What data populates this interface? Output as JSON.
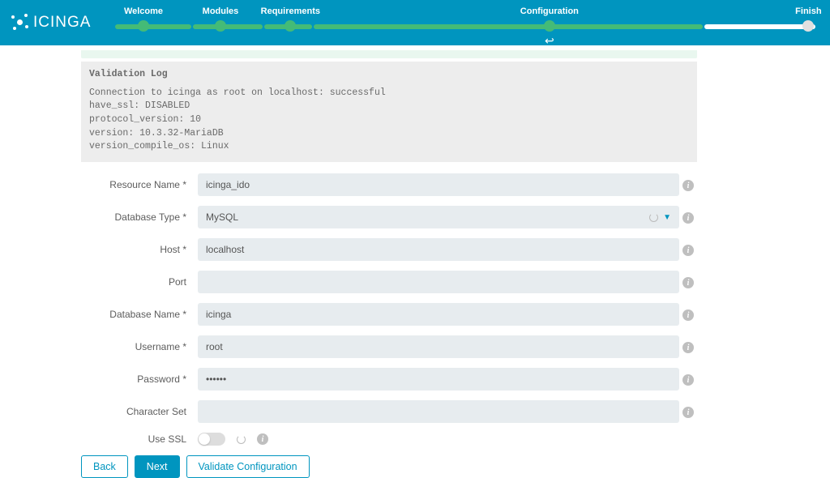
{
  "brand": "ICINGA",
  "wizard": {
    "steps": [
      "Welcome",
      "Modules",
      "Requirements",
      "Configuration",
      "Finish"
    ],
    "current_index": 3
  },
  "validation_log": {
    "title": "Validation Log",
    "lines": [
      "Connection to icinga as root on localhost: successful",
      "have_ssl: DISABLED",
      "protocol_version: 10",
      "version: 10.3.32-MariaDB",
      "version_compile_os: Linux"
    ]
  },
  "form": {
    "resource_name": {
      "label": "Resource Name *",
      "value": "icinga_ido"
    },
    "database_type": {
      "label": "Database Type *",
      "value": "MySQL"
    },
    "host": {
      "label": "Host *",
      "value": "localhost"
    },
    "port": {
      "label": "Port",
      "value": ""
    },
    "database_name": {
      "label": "Database Name *",
      "value": "icinga"
    },
    "username": {
      "label": "Username *",
      "value": "root"
    },
    "password": {
      "label": "Password *",
      "value": "••••••"
    },
    "character_set": {
      "label": "Character Set",
      "value": ""
    },
    "use_ssl": {
      "label": "Use SSL",
      "value": false
    }
  },
  "buttons": {
    "back": "Back",
    "next": "Next",
    "validate": "Validate Configuration"
  }
}
